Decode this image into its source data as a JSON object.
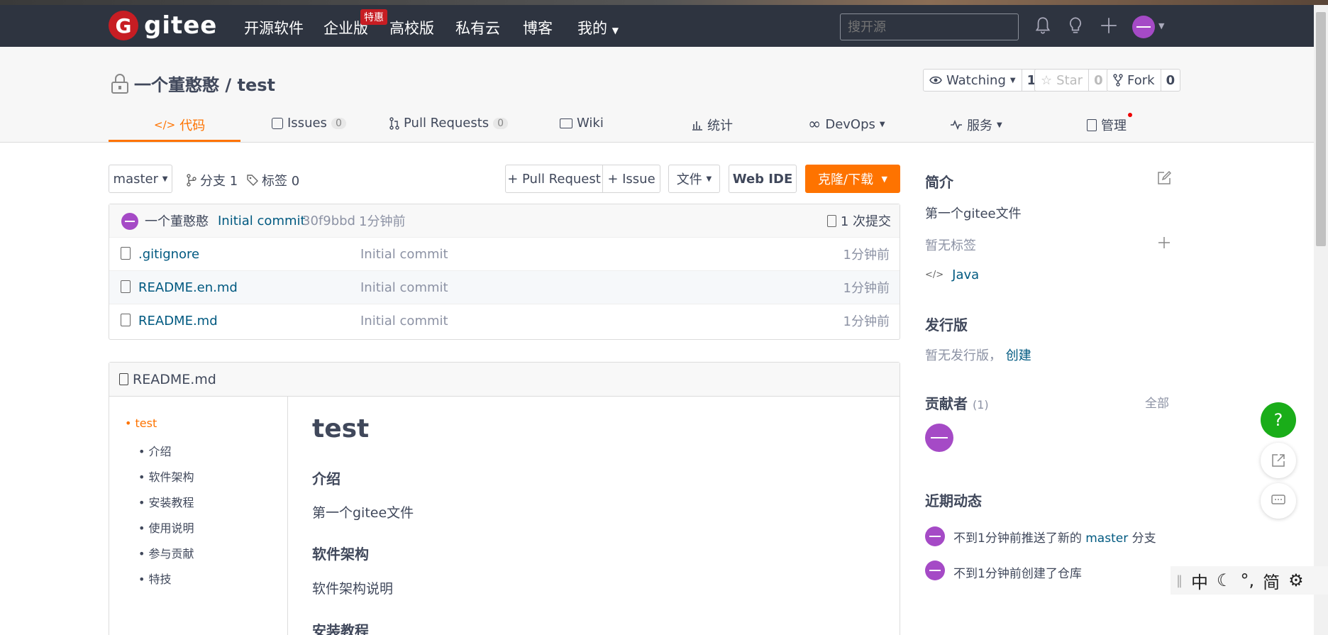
{
  "nav": {
    "logo_letter": "G",
    "logo_text": "gitee",
    "items": [
      "开源软件",
      "企业版",
      "高校版",
      "私有云",
      "博客",
      "我的"
    ],
    "hot_badge": "特惠",
    "search_placeholder": "搜开源"
  },
  "repo": {
    "title": "一个董憨憨 / test",
    "watch_label": "Watching",
    "watch_count": "1",
    "star_label": "Star",
    "star_count": "0",
    "fork_label": "Fork",
    "fork_count": "0"
  },
  "tabs": [
    {
      "label": "代码"
    },
    {
      "label": "Issues",
      "count": "0"
    },
    {
      "label": "Pull Requests",
      "count": "0"
    },
    {
      "label": "Wiki"
    },
    {
      "label": "统计"
    },
    {
      "label": "DevOps"
    },
    {
      "label": "服务"
    },
    {
      "label": "管理"
    }
  ],
  "toolbar": {
    "branch": "master",
    "branches": "分支 1",
    "tags": "标签 0",
    "pr": "+ Pull Request",
    "issue": "+ Issue",
    "file": "文件",
    "webide": "Web IDE",
    "clone": "克隆/下载"
  },
  "commit": {
    "author": "一个董憨憨",
    "message": "Initial commit",
    "hash": "30f9bbd",
    "time": "1分钟前",
    "total": "1 次提交"
  },
  "files": [
    {
      "name": ".gitignore",
      "message": "Initial commit",
      "time": "1分钟前"
    },
    {
      "name": "README.en.md",
      "message": "Initial commit",
      "time": "1分钟前"
    },
    {
      "name": "README.md",
      "message": "Initial commit",
      "time": "1分钟前"
    }
  ],
  "readme": {
    "filename": "README.md",
    "toc": [
      "test",
      "介绍",
      "软件架构",
      "安装教程",
      "使用说明",
      "参与贡献",
      "特技"
    ],
    "h1": "test",
    "h_intro": "介绍",
    "intro_text": "第一个gitee文件",
    "h_arch": "软件架构",
    "arch_text": "软件架构说明",
    "h_install": "安装教程"
  },
  "sidebar": {
    "intro_title": "简介",
    "description": "第一个gitee文件",
    "no_tags": "暂无标签",
    "language": "Java",
    "release_title": "发行版",
    "no_release": "暂无发行版，",
    "create_link": "创建",
    "contrib_title": "贡献者",
    "contrib_count": "(1)",
    "all_link": "全部",
    "activity_title": "近期动态",
    "activity1_pre": "不到1分钟前推送了新的",
    "activity1_branch": "master",
    "activity1_post": "分支",
    "activity2": "不到1分钟前创建了仓库"
  },
  "ime": {
    "lang": "中",
    "punct": "°,",
    "mode": "简"
  },
  "colors": {
    "nav": "#2e3440",
    "accent": "#fe7300",
    "avatar": "#a54ac6",
    "link": "#005980",
    "help": "#1aad19"
  }
}
